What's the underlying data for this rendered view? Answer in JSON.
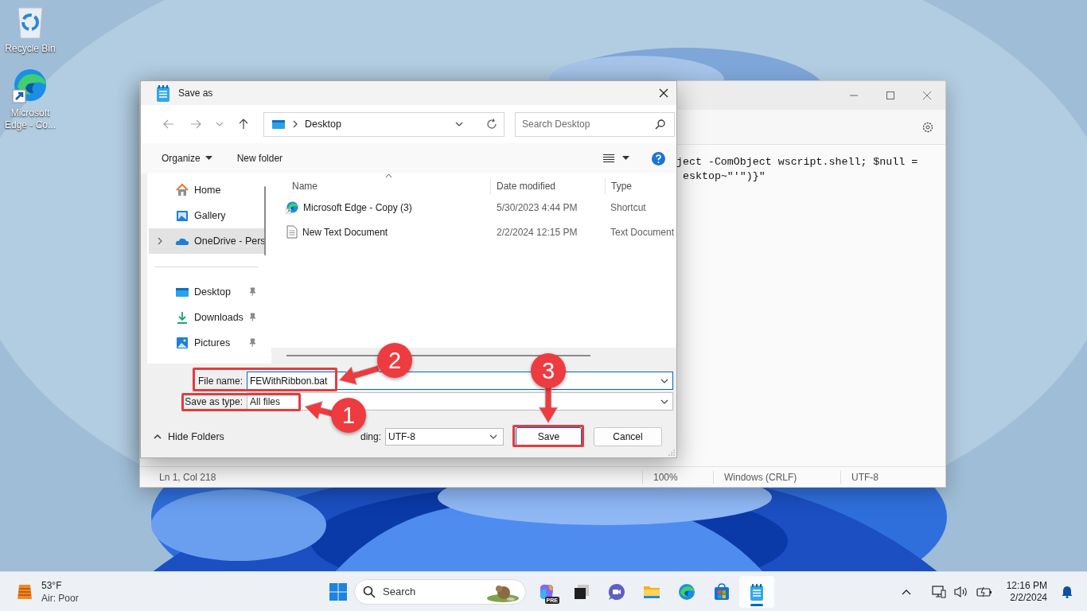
{
  "desktop_icons": [
    {
      "label": "Recycle Bin",
      "kind": "recycle"
    },
    {
      "label": "Microsoft Edge - Co...",
      "kind": "edge"
    }
  ],
  "notepad": {
    "editor_lines": [
      "ject -ComObject wscript.shell; $null =",
      "esktop~\"'\")}\""
    ],
    "status_bar": [
      "Ln 1, Col 218",
      "100%",
      "Windows (CRLF)",
      "UTF-8"
    ]
  },
  "dialog": {
    "title": "Save as",
    "address": "Desktop",
    "search": {
      "placeholder": "Search Desktop"
    },
    "toolbar": {
      "organize": "Organize",
      "new_folder": "New folder"
    },
    "nav_sections": [
      {
        "items": [
          {
            "label": "Home",
            "kind": "home",
            "selected": false,
            "expandable": false,
            "pinned": false
          },
          {
            "label": "Gallery",
            "kind": "gallery",
            "selected": false,
            "expandable": false,
            "pinned": false
          },
          {
            "label": "OneDrive - Pers",
            "kind": "cloud",
            "selected": true,
            "expandable": true,
            "pinned": false
          }
        ]
      },
      {
        "items": [
          {
            "label": "Desktop",
            "kind": "desktop",
            "selected": false,
            "expandable": false,
            "pinned": true
          },
          {
            "label": "Downloads",
            "kind": "downloads",
            "selected": false,
            "expandable": false,
            "pinned": true
          },
          {
            "label": "Pictures",
            "kind": "pictures",
            "selected": false,
            "expandable": false,
            "pinned": true
          }
        ]
      }
    ],
    "columns": [
      "Name",
      "Date modified",
      "Type"
    ],
    "files": [
      {
        "name": "Microsoft Edge - Copy (3)",
        "date": "5/30/2023 4:44 PM",
        "type": "Shortcut",
        "kind": "shortcut"
      },
      {
        "name": "New Text Document",
        "date": "2/2/2024 12:15 PM",
        "type": "Text Document",
        "kind": "text"
      }
    ],
    "file_name": {
      "label": "File name:",
      "value": "FEWithRibbon.bat"
    },
    "save_as_type": {
      "label": "Save as type:",
      "value": "All files"
    },
    "hide_folders": "Hide Folders",
    "encoding": {
      "label": "ding:",
      "value": "UTF-8"
    },
    "buttons": [
      "Save",
      "Cancel"
    ]
  },
  "annotations": [
    {
      "number": "2"
    },
    {
      "number": "1"
    },
    {
      "number": "3"
    }
  ],
  "taskbar": {
    "weather": {
      "temperature": "53°F",
      "condition": "Air: Poor"
    },
    "search": {
      "label": "Search"
    },
    "apps": [
      {
        "kind": "copilot",
        "badge": "PRE",
        "active": false
      },
      {
        "kind": "task_view",
        "active": false
      },
      {
        "kind": "chat",
        "active": false
      },
      {
        "kind": "explorer",
        "active": false
      },
      {
        "kind": "edge",
        "active": false
      },
      {
        "kind": "store",
        "active": false
      },
      {
        "kind": "notepad",
        "active": true
      }
    ],
    "clock": {
      "time": "12:16 PM",
      "date": "2/2/2024"
    }
  }
}
